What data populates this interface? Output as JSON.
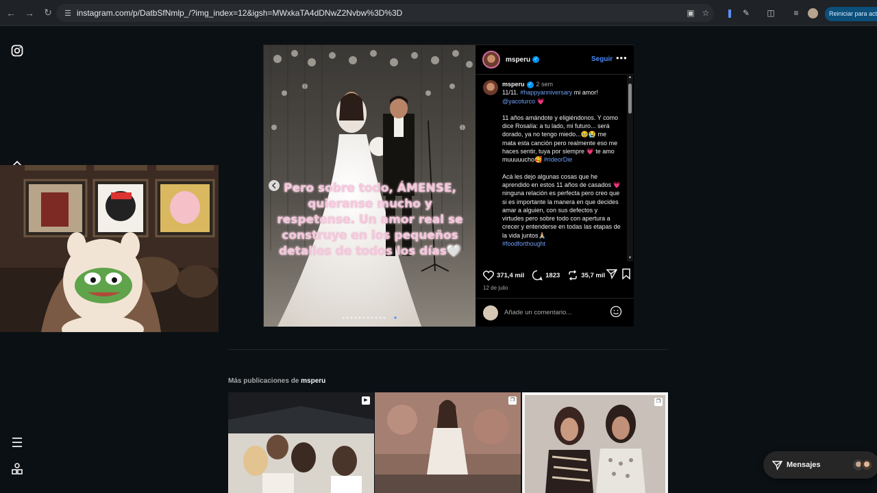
{
  "browser": {
    "url": "instagram.com/p/DatbSfNmlp_/?img_index=12&igsh=MWxkaTA4dDNwZ2Nvbw%3D%3D",
    "restart_label": "Reiniciar para actu"
  },
  "post": {
    "username": "msperu",
    "follow_label": "Seguir",
    "image_overlay_text": "Pero sobre todo, ÁMENSE, quieranse mucho y respetense. Un amor real se construye en los pequeños detalles de todos los días🤍",
    "caption": {
      "username": "msperu",
      "time": "2 sem",
      "line1_prefix": "11/11. ",
      "hashtag1": "#happyanniversary",
      "line1_suffix": " mi amor!",
      "mention": "@yacoturco",
      "mention_emoji": " 💗",
      "para2": "11 años amándote y eligiéndonos. Y como dice Rosalía: a tu lado, mi futuro... será dorado, ya no tengo miedo...🥹😭 me mata esta canción pero realmente eso me haces sentir, tuya por siempre 💗 te amo muuuuucho🥰 ",
      "hashtag2": "#rideorDie",
      "para3": "Acá les dejo algunas cosas que he aprendido en estos 11 años de casados 💗 ninguna relación es perfecta pero creo que si es importante la manera en que decides amar a alguien, con sus defectos y virtudes pero sobre todo con apertura a crecer y entenderse en todas las etapas de la vida juntos🙏🏼",
      "hashtag3": "#foodforthought"
    },
    "likes": "371,4 mil",
    "comments": "1823",
    "reposts": "35,7 mil",
    "date": "12 de julio",
    "comment_placeholder": "Añade un comentario..."
  },
  "more_posts": {
    "prefix": "Más publicaciones de ",
    "username": "msperu"
  },
  "messages": {
    "label": "Mensajes"
  }
}
